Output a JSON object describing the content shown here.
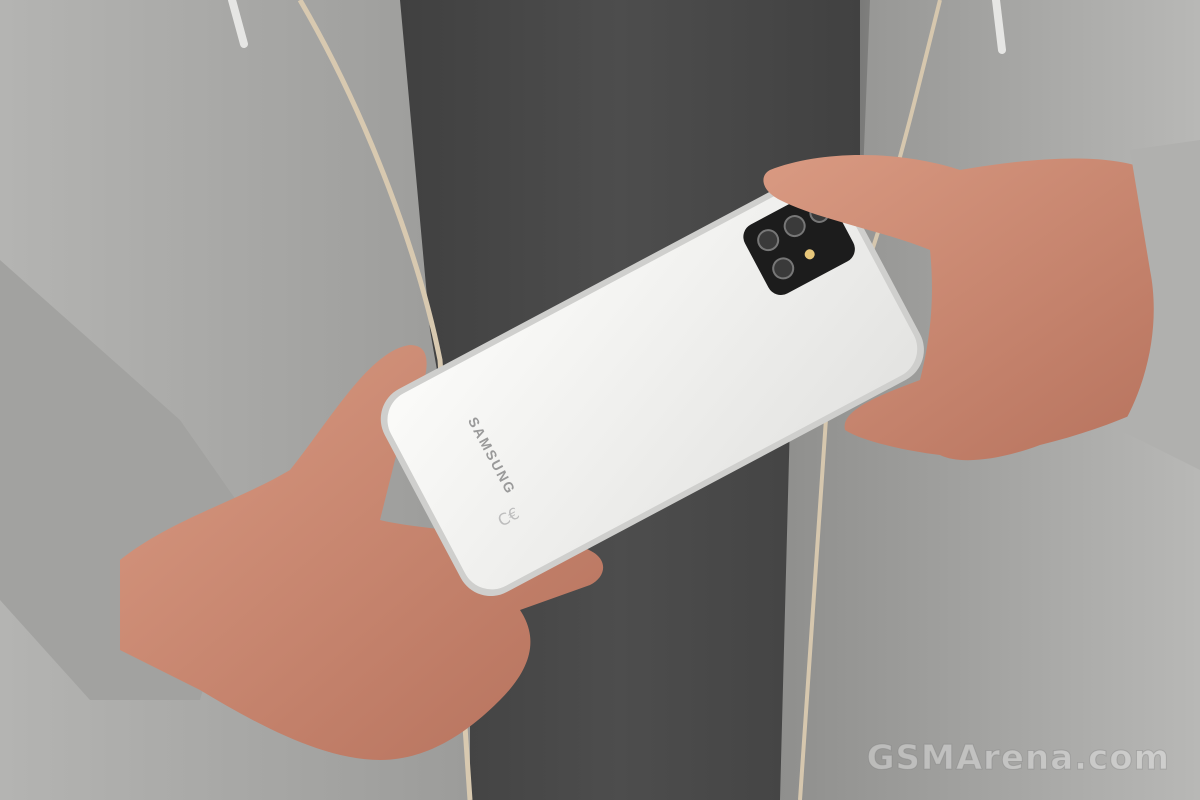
{
  "photo": {
    "subject": "phone-back",
    "brand_text": "SAMSUNG",
    "watermark": "GSMArena.com",
    "colors": {
      "hoodie": "#a7a7a5",
      "shirt": "#4a4a4a",
      "phone": "#f1f1ef",
      "skin": "#c98a73",
      "camera": "#1a1a1a"
    }
  }
}
